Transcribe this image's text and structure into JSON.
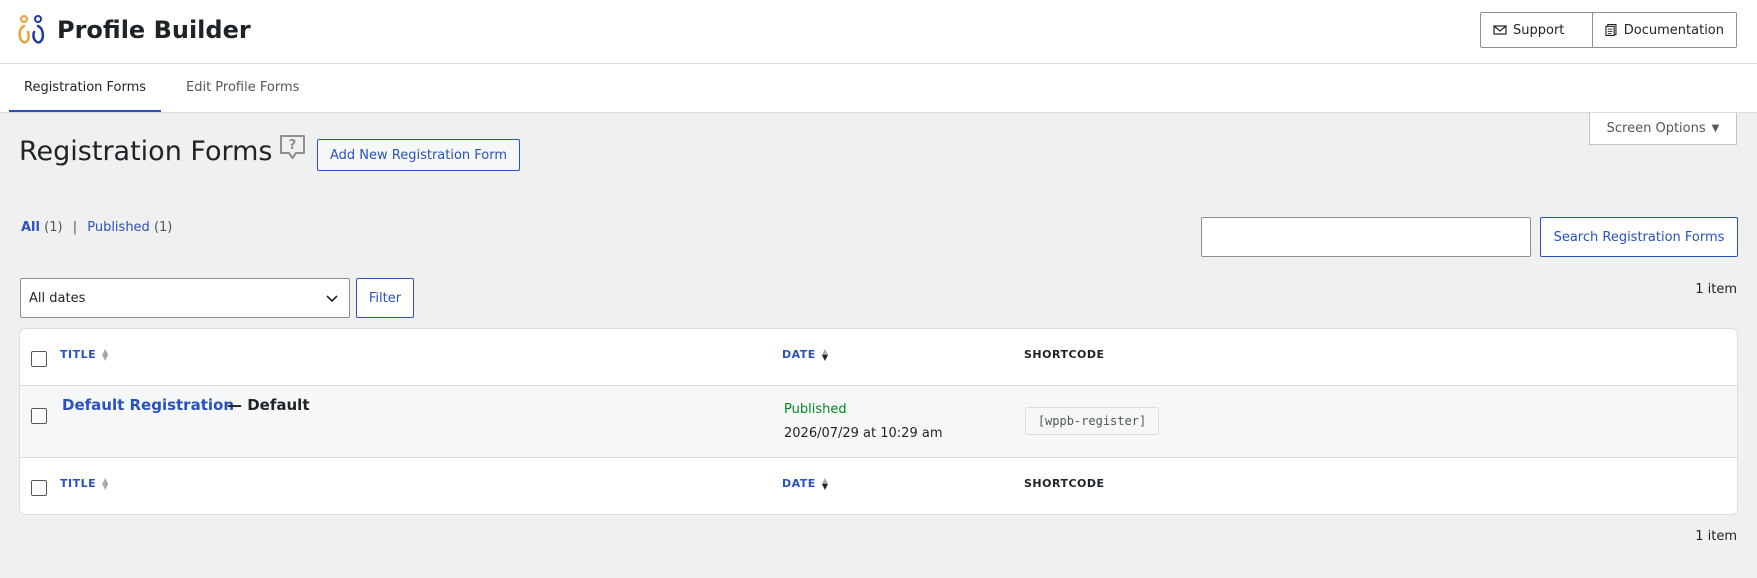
{
  "header": {
    "brand": "Profile Builder",
    "support_label": "Support",
    "docs_label": "Documentation"
  },
  "tabs": [
    {
      "label": "Registration Forms",
      "active": true
    },
    {
      "label": "Edit Profile Forms",
      "active": false
    }
  ],
  "screen_options": "Screen Options",
  "page": {
    "title": "Registration Forms",
    "add_new_label": "Add New Registration Form"
  },
  "views": {
    "all_label": "All",
    "all_count": "(1)",
    "published_label": "Published",
    "published_count": "(1)"
  },
  "search": {
    "value": "",
    "button_label": "Search Registration Forms"
  },
  "filters": {
    "date_selected": "All dates",
    "filter_label": "Filter"
  },
  "pagination": {
    "items_top": "1 item",
    "items_bottom": "1 item"
  },
  "table": {
    "columns": {
      "title": "TITLE",
      "date": "DATE",
      "shortcode": "SHORTCODE"
    },
    "rows": [
      {
        "title": "Default Registration",
        "suffix": "— Default",
        "status": "Published",
        "datetime": "2026/07/29 at 10:29 am",
        "shortcode": "[wppb-register]"
      }
    ]
  },
  "colors": {
    "accent": "#2a52be",
    "published": "#008a20",
    "logo_orange": "#e9a23b",
    "logo_blue": "#1e3a9c"
  },
  "icons": {
    "support": "envelope-icon",
    "docs": "document-icon",
    "help": "help-bubble-icon",
    "select": "chevron-down-icon"
  }
}
